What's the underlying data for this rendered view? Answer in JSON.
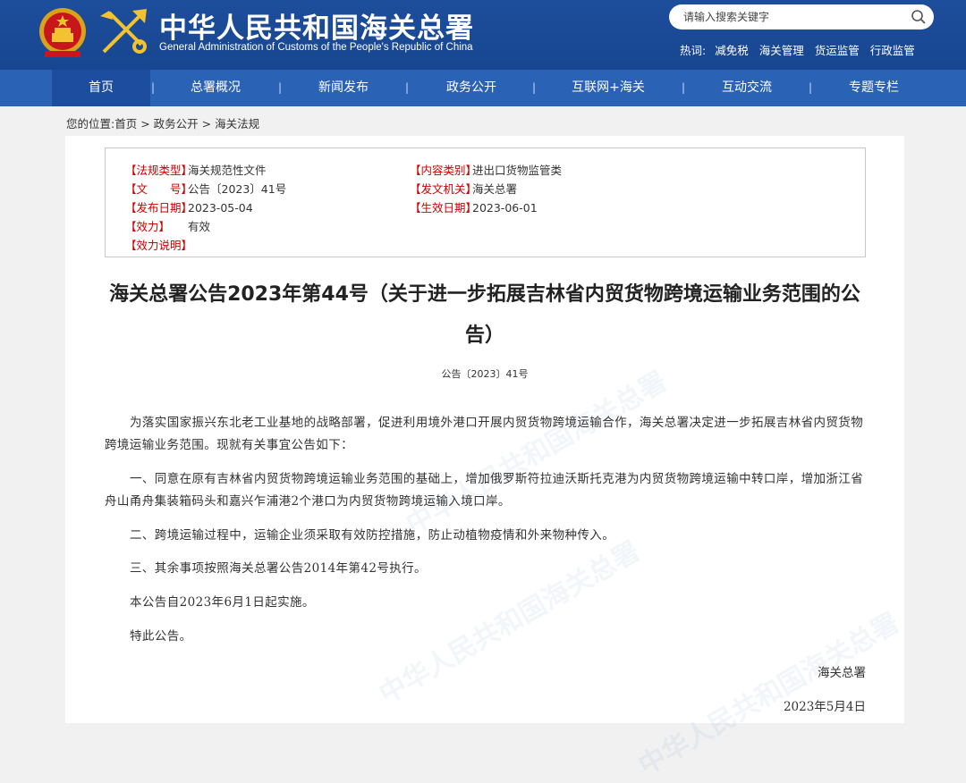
{
  "header": {
    "title": "中华人民共和国海关总署",
    "subtitle": "General Administration of Customs of the People's Republic of China",
    "search": {
      "placeholder": "请输入搜索关键字"
    },
    "hot": {
      "label": "热词:",
      "words": [
        "减免税",
        "海关管理",
        "货运监管",
        "行政监管"
      ]
    }
  },
  "nav": {
    "items": [
      "首页",
      "总署概况",
      "新闻发布",
      "政务公开",
      "互联网+海关",
      "互动交流",
      "专题专栏"
    ],
    "separator": "|"
  },
  "breadcrumb": {
    "prefix": "您的位置:",
    "items": [
      "首页",
      "政务公开",
      "海关法规"
    ],
    "sep": " > "
  },
  "meta": {
    "law_type": {
      "label": "【法规类型】",
      "value": "海关规范性文件"
    },
    "content_type": {
      "label": "【内容类别】",
      "value": "进出口货物监管类"
    },
    "doc_no": {
      "label": "【文　　号】",
      "value": "公告〔2023〕41号"
    },
    "issuer": {
      "label": "【发文机关】",
      "value": "海关总署"
    },
    "issue_date": {
      "label": "【发布日期】",
      "value": "2023-05-04"
    },
    "effective_date": {
      "label": "【生效日期】",
      "value": "2023-06-01"
    },
    "validity": {
      "label": "【效力】",
      "value": "有效"
    },
    "validity_note": {
      "label": "【效力说明】",
      "value": ""
    }
  },
  "article": {
    "title": "海关总署公告2023年第44号（关于进一步拓展吉林省内贸货物跨境运输业务范围的公告）",
    "number": "公告〔2023〕41号",
    "paragraphs": [
      "为落实国家振兴东北老工业基地的战略部署，促进利用境外港口开展内贸货物跨境运输合作，海关总署决定进一步拓展吉林省内贸货物跨境运输业务范围。现就有关事宜公告如下：",
      "一、同意在原有吉林省内贸货物跨境运输业务范围的基础上，增加俄罗斯符拉迪沃斯托克港为内贸货物跨境运输中转口岸，增加浙江省舟山甬舟集装箱码头和嘉兴乍浦港2个港口为内贸货物跨境运输入境口岸。",
      "二、跨境运输过程中，运输企业须采取有效防控措施，防止动植物疫情和外来物种传入。",
      "三、其余事项按照海关总署公告2014年第42号执行。",
      "本公告自2023年6月1日起实施。",
      "特此公告。"
    ],
    "signature": "海关总署",
    "date": "2023年5月4日"
  },
  "colors": {
    "header_bg": "#1d4e9c",
    "nav_bg": "#2a63b5",
    "label_red": "#cc0000"
  }
}
